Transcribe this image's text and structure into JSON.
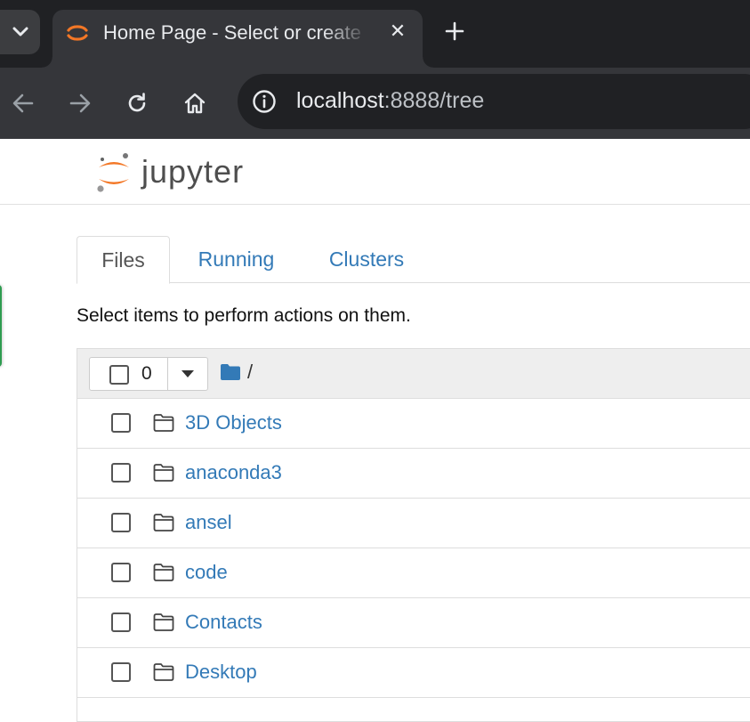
{
  "browser": {
    "tab": {
      "title": "Home Page - Select or create",
      "close_glyph": "✕",
      "favicon": "jupyter-favicon"
    },
    "new_tab_icon": "plus-icon",
    "tab_search_icon": "chevron-down-icon",
    "nav": {
      "back_icon": "arrow-left-icon",
      "forward_icon": "arrow-right-icon",
      "reload_icon": "reload-icon",
      "home_icon": "home-icon"
    },
    "address": {
      "host": "localhost",
      "rest": ":8888/tree",
      "site_info_icon": "info-icon"
    }
  },
  "jupyter": {
    "logo_text": "jupyter",
    "tabs": [
      {
        "label": "Files",
        "active": true
      },
      {
        "label": "Running",
        "active": false
      },
      {
        "label": "Clusters",
        "active": false
      }
    ],
    "hint": "Select items to perform actions on them.",
    "selection": {
      "count": "0",
      "caret_icon": "caret-down-icon"
    },
    "breadcrumb": {
      "folder_icon": "folder-icon",
      "path": "/"
    },
    "items": [
      {
        "name": "3D Objects",
        "type": "folder"
      },
      {
        "name": "anaconda3",
        "type": "folder"
      },
      {
        "name": "ansel",
        "type": "folder"
      },
      {
        "name": "code",
        "type": "folder"
      },
      {
        "name": "Contacts",
        "type": "folder"
      },
      {
        "name": "Desktop",
        "type": "folder"
      }
    ]
  },
  "colors": {
    "link": "#337ab7",
    "jupyter_orange": "#f37726",
    "chrome_dark": "#202124",
    "chrome_toolbar": "#35363a"
  }
}
